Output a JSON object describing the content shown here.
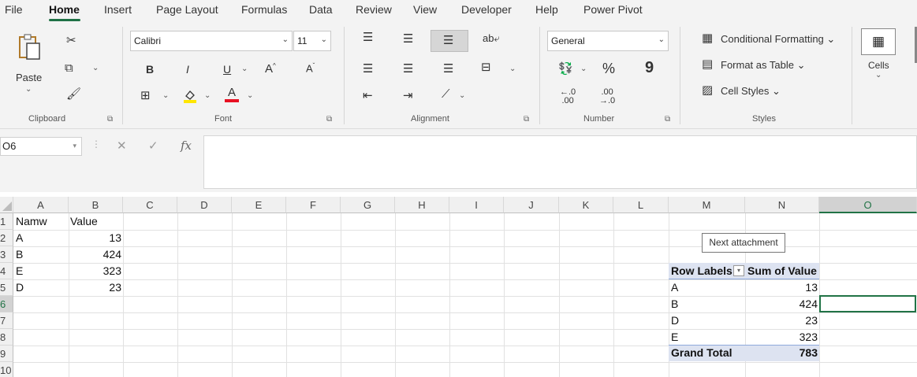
{
  "menu": {
    "tabs": [
      "File",
      "Home",
      "Insert",
      "Page Layout",
      "Formulas",
      "Data",
      "Review",
      "View",
      "Developer",
      "Help",
      "Power Pivot"
    ],
    "active": "Home"
  },
  "ribbon": {
    "clipboard": {
      "paste_label": "Paste",
      "group_label": "Clipboard"
    },
    "font": {
      "font_name": "Calibri",
      "font_size": "11",
      "group_label": "Font",
      "bold": "B",
      "italic": "I",
      "underline": "U",
      "grow": "A",
      "shrink": "A",
      "font_color_letter": "A"
    },
    "alignment": {
      "group_label": "Alignment"
    },
    "number": {
      "format": "General",
      "percent": "%",
      "comma": "9",
      "group_label": "Number"
    },
    "styles": {
      "conditional": "Conditional Formatting",
      "format_table": "Format as Table",
      "cell_styles": "Cell Styles",
      "group_label": "Styles"
    },
    "cells": {
      "label": "Cells"
    },
    "colors": {
      "font_color": "#e81123",
      "highlight": "#ffe600",
      "accent": "#217346"
    }
  },
  "formula_bar": {
    "name_box": "O6",
    "fx": "fx",
    "content": ""
  },
  "grid": {
    "columns": [
      "A",
      "B",
      "C",
      "D",
      "E",
      "F",
      "G",
      "H",
      "I",
      "J",
      "K",
      "L",
      "M",
      "N",
      "O"
    ],
    "rows": [
      "1",
      "2",
      "3",
      "4",
      "5",
      "6",
      "7",
      "8",
      "9",
      "10"
    ],
    "selected_column": "O",
    "selected_row": "6",
    "data": {
      "header": [
        "Namw",
        "Value"
      ],
      "rows": [
        {
          "name": "A",
          "value": "13"
        },
        {
          "name": "B",
          "value": "424"
        },
        {
          "name": "E",
          "value": "323"
        },
        {
          "name": "D",
          "value": "23"
        }
      ]
    },
    "pivot": {
      "header": [
        "Row Labels",
        "Sum of Value"
      ],
      "rows": [
        {
          "label": "A",
          "value": "13"
        },
        {
          "label": "B",
          "value": "424"
        },
        {
          "label": "D",
          "value": "23"
        },
        {
          "label": "E",
          "value": "323"
        }
      ],
      "total_label": "Grand Total",
      "total_value": "783"
    },
    "tooltip": "Next attachment"
  }
}
